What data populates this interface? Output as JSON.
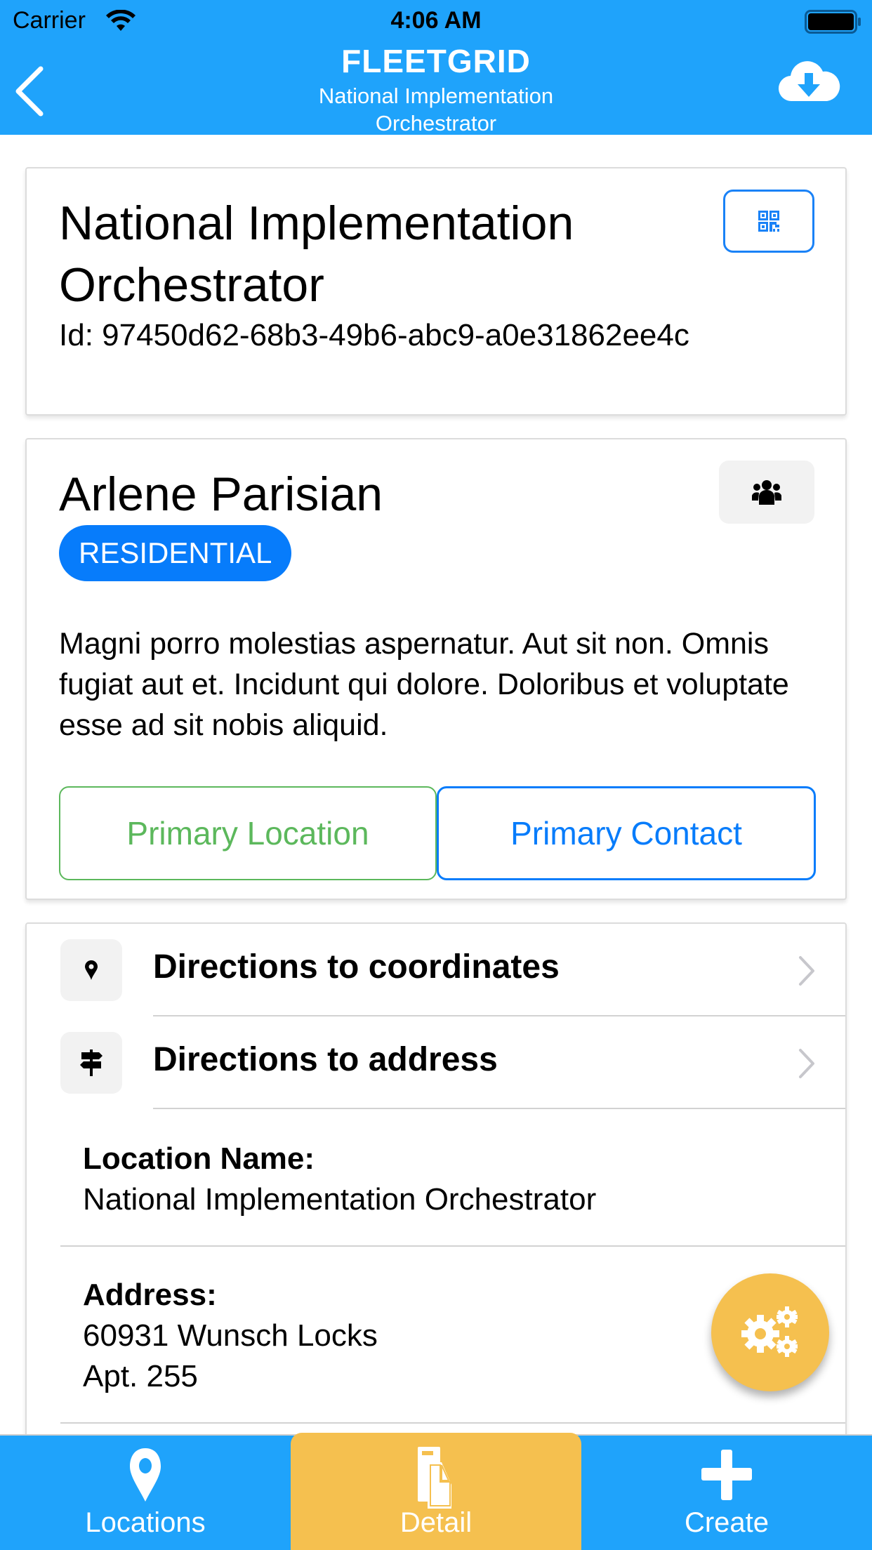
{
  "status_bar": {
    "carrier": "Carrier",
    "time": "4:06 AM",
    "icons": [
      "wifi-icon",
      "battery-icon"
    ]
  },
  "header": {
    "title": "FLEETGRID",
    "subtitle_line1": "National Implementation",
    "subtitle_line2": "Orchestrator",
    "back_icon": "chevron-left-icon",
    "action_icon": "cloud-download-icon"
  },
  "location_card": {
    "title": "National Implementation Orchestrator",
    "id_text": "Id: 97450d62-68b3-49b6-abc9-a0e31862ee4c",
    "qr_icon": "qrcode-icon"
  },
  "contact_card": {
    "name": "Arlene Parisian",
    "type_badge": "RESIDENTIAL",
    "contacts_icon": "users-icon",
    "description": "Magni porro molestias aspernatur. Aut sit non. Omnis fugiat aut et. Incidunt qui dolore. Doloribus et voluptate esse ad sit nobis aliquid.",
    "primary_location_label": "Primary Location",
    "primary_contact_label": "Primary Contact"
  },
  "details_card": {
    "nav_rows": [
      {
        "label": "Directions to coordinates",
        "icon": "map-marker-icon"
      },
      {
        "label": "Directions to address",
        "icon": "signpost-icon"
      }
    ],
    "fields": [
      {
        "label": "Location Name:",
        "value": "National Implementation Orchestrator"
      },
      {
        "label": "Address:",
        "value_line1": "60931 Wunsch Locks",
        "value_line2": "Apt. 255"
      }
    ]
  },
  "fab": {
    "icon": "cogs-icon"
  },
  "tabbar": {
    "tabs": [
      {
        "label": "Locations",
        "icon": "map-marker-icon",
        "active": false
      },
      {
        "label": "Detail",
        "icon": "documents-icon",
        "active": true
      },
      {
        "label": "Create",
        "icon": "plus-icon",
        "active": false
      }
    ]
  },
  "colors": {
    "header_blue": "#1fa3fb",
    "active_tab_yellow": "#f5c04f",
    "badge_blue": "#077cfb",
    "success_green": "#5cb85c"
  }
}
